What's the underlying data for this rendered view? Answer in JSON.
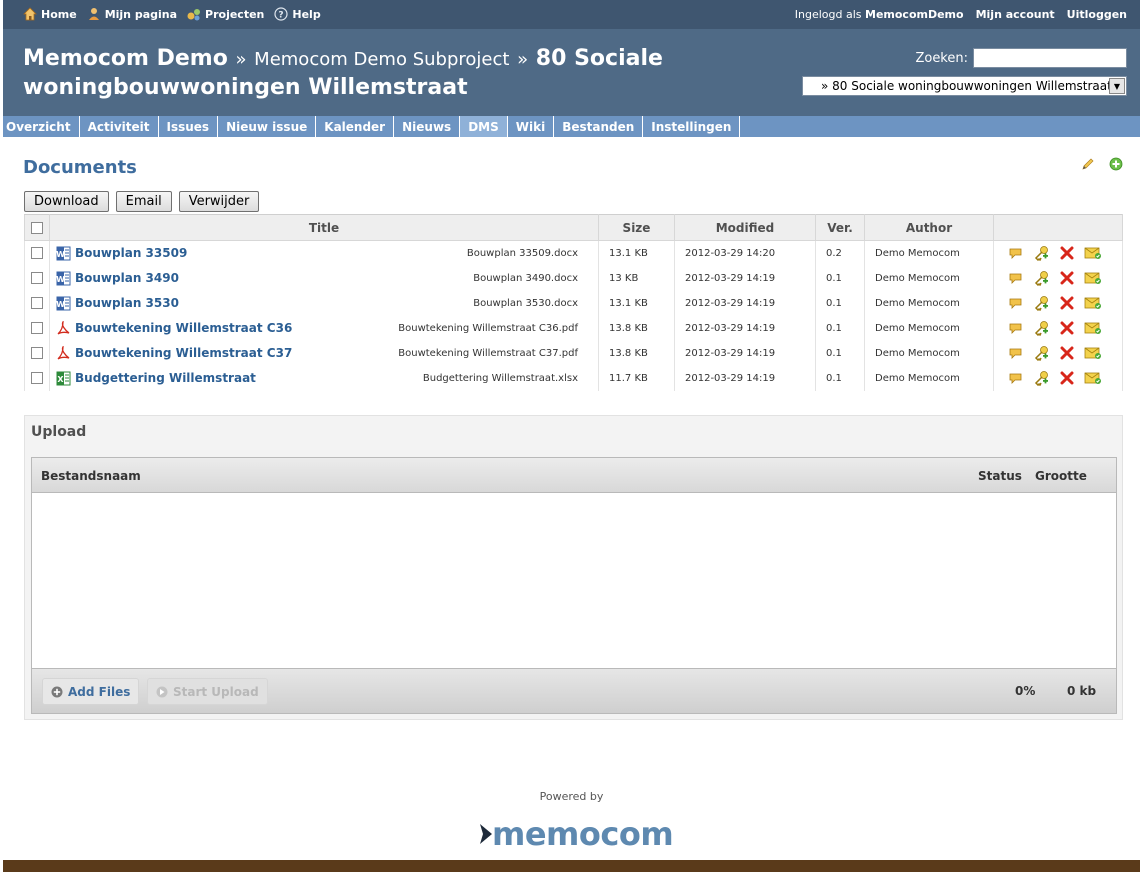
{
  "top_menu": {
    "home": "Home",
    "my_page": "Mijn pagina",
    "projects": "Projecten",
    "help": "Help",
    "logged_in_prefix": "Ingelogd als",
    "username": "MemocomDemo",
    "my_account": "Mijn account",
    "logout": "Uitloggen"
  },
  "header": {
    "crumb_root": "Memocom Demo",
    "crumb_sub": "Memocom Demo Subproject",
    "separator": "»",
    "project_title": "80 Sociale woningbouwwoningen Willemstraat",
    "search_label": "Zoeken:",
    "project_select_value": "» 80 Sociale woningbouwwoningen Willemstraat"
  },
  "main_menu": [
    {
      "label": "Overzicht",
      "selected": false
    },
    {
      "label": "Activiteit",
      "selected": false
    },
    {
      "label": "Issues",
      "selected": false
    },
    {
      "label": "Nieuw issue",
      "selected": false
    },
    {
      "label": "Kalender",
      "selected": false
    },
    {
      "label": "Nieuws",
      "selected": false
    },
    {
      "label": "DMS",
      "selected": true
    },
    {
      "label": "Wiki",
      "selected": false
    },
    {
      "label": "Bestanden",
      "selected": false
    },
    {
      "label": "Instellingen",
      "selected": false
    }
  ],
  "documents": {
    "title": "Documents",
    "buttons": {
      "download": "Download",
      "email": "Email",
      "delete": "Verwijder"
    },
    "columns": {
      "title": "Title",
      "size": "Size",
      "modified": "Modified",
      "version": "Ver.",
      "author": "Author"
    },
    "rows": [
      {
        "title": "Bouwplan 33509",
        "file": "Bouwplan 33509.docx",
        "type": "word",
        "size": "13.1 KB",
        "modified": "2012-03-29 14:20",
        "version": "0.2",
        "author": "Demo Memocom"
      },
      {
        "title": "Bouwplan 3490",
        "file": "Bouwplan 3490.docx",
        "type": "word",
        "size": "13 KB",
        "modified": "2012-03-29 14:19",
        "version": "0.1",
        "author": "Demo Memocom"
      },
      {
        "title": "Bouwplan 3530",
        "file": "Bouwplan 3530.docx",
        "type": "word",
        "size": "13.1 KB",
        "modified": "2012-03-29 14:19",
        "version": "0.1",
        "author": "Demo Memocom"
      },
      {
        "title": "Bouwtekening Willemstraat C36",
        "file": "Bouwtekening Willemstraat C36.pdf",
        "type": "pdf",
        "size": "13.8 KB",
        "modified": "2012-03-29 14:19",
        "version": "0.1",
        "author": "Demo Memocom"
      },
      {
        "title": "Bouwtekening Willemstraat C37",
        "file": "Bouwtekening Willemstraat C37.pdf",
        "type": "pdf",
        "size": "13.8 KB",
        "modified": "2012-03-29 14:19",
        "version": "0.1",
        "author": "Demo Memocom"
      },
      {
        "title": "Budgettering Willemstraat",
        "file": "Budgettering Willemstraat.xlsx",
        "type": "excel",
        "size": "11.7 KB",
        "modified": "2012-03-29 14:19",
        "version": "0.1",
        "author": "Demo Memocom"
      }
    ]
  },
  "upload": {
    "title": "Upload",
    "col_filename": "Bestandsnaam",
    "col_status": "Status",
    "col_size": "Grootte",
    "add_files": "Add Files",
    "start_upload": "Start Upload",
    "percent": "0%",
    "total_size": "0 kb"
  },
  "footer": {
    "powered_by": "Powered by",
    "logo_text": "memocom"
  },
  "colors": {
    "top_bar": "#3f5670",
    "header": "#4f6a86",
    "main_menu": "#6d94c2",
    "link": "#2b5e93",
    "footer_bar": "#5a3a1a"
  }
}
